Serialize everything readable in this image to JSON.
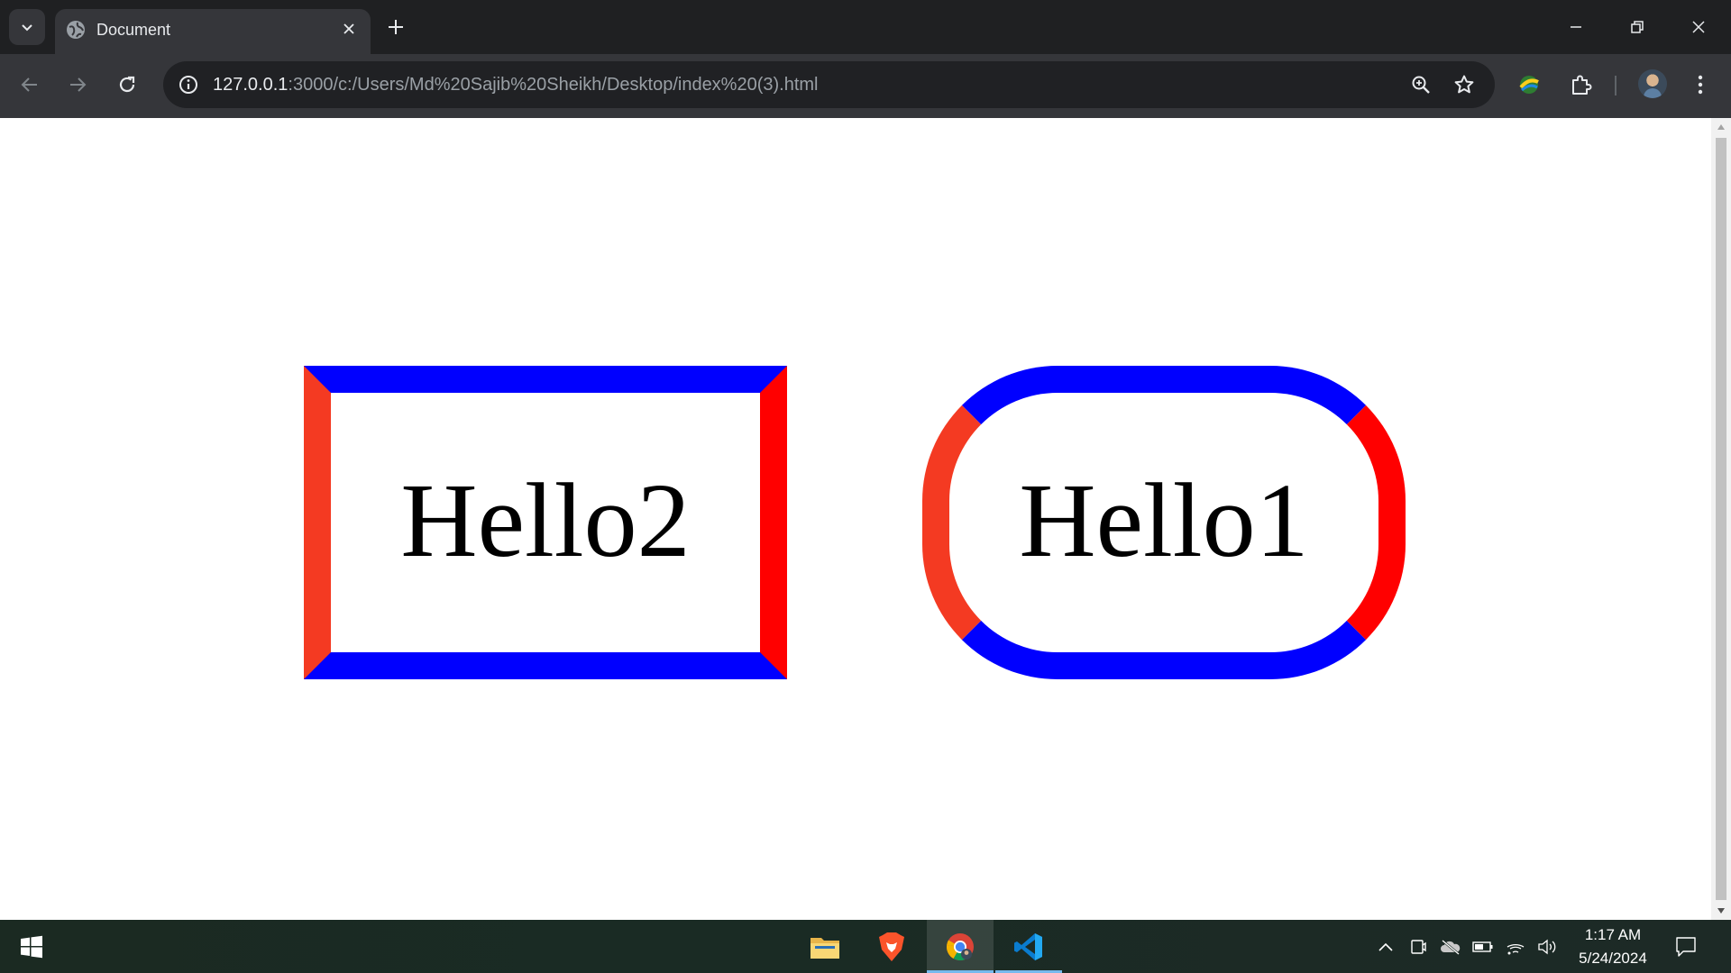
{
  "browser": {
    "tab": {
      "title": "Document",
      "favicon": "globe-icon"
    },
    "address_bar": {
      "host": "127.0.0.1",
      "path": ":3000/c:/Users/Md%20Sajib%20Sheikh/Desktop/index%20(3).html"
    },
    "icons": {
      "tab_search": "chevron-down-icon",
      "tab_close": "close-icon",
      "new_tab": "plus-icon",
      "minimize": "minimize-icon",
      "restore": "restore-icon",
      "close_window": "close-icon",
      "back": "arrow-left-icon",
      "forward": "arrow-right-icon",
      "reload": "reload-icon",
      "site_info": "info-icon",
      "zoom": "zoom-icon",
      "bookmark": "star-icon",
      "extension_feature": "extension-icon",
      "extensions": "puzzle-icon",
      "profile": "avatar",
      "menu": "more-vert-icon"
    }
  },
  "page": {
    "box_square": {
      "text": "Hello2"
    },
    "box_round": {
      "text": "Hello1"
    },
    "colors": {
      "border_top_bottom": "#0000ff",
      "border_left": "#f43a22",
      "border_right": "#ff0000"
    }
  },
  "taskbar": {
    "apps": [
      {
        "name": "File Explorer",
        "icon": "folder-icon",
        "active": false
      },
      {
        "name": "Brave",
        "icon": "brave-icon",
        "active": false
      },
      {
        "name": "Chrome",
        "icon": "chrome-icon",
        "active": true
      },
      {
        "name": "Visual Studio Code",
        "icon": "vscode-icon",
        "active": false
      }
    ],
    "clock": {
      "time": "1:17 AM",
      "date": "5/24/2024"
    }
  }
}
